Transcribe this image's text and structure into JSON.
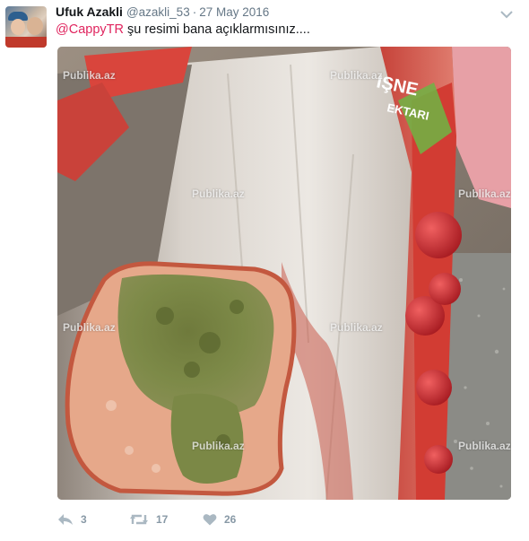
{
  "tweet": {
    "author_name": "Ufuk Azakli",
    "author_handle": "@azakli_53",
    "separator": "·",
    "date": "27 May 2016",
    "mention": "@CappyTR",
    "text": " şu resimi bana açıklarmısınız...."
  },
  "media": {
    "watermark": "Publika.az",
    "carton_text_1": "IŞNE",
    "carton_text_2": "EKTARI"
  },
  "actions": {
    "reply_count": "3",
    "retweet_count": "17",
    "like_count": "26"
  },
  "colors": {
    "mention": "#e0245e",
    "action_icon": "#aab8c2",
    "muted_text": "#657786"
  },
  "icons": {
    "reply": "reply-icon",
    "retweet": "retweet-icon",
    "like": "heart-icon",
    "menu": "chevron-down-icon"
  }
}
